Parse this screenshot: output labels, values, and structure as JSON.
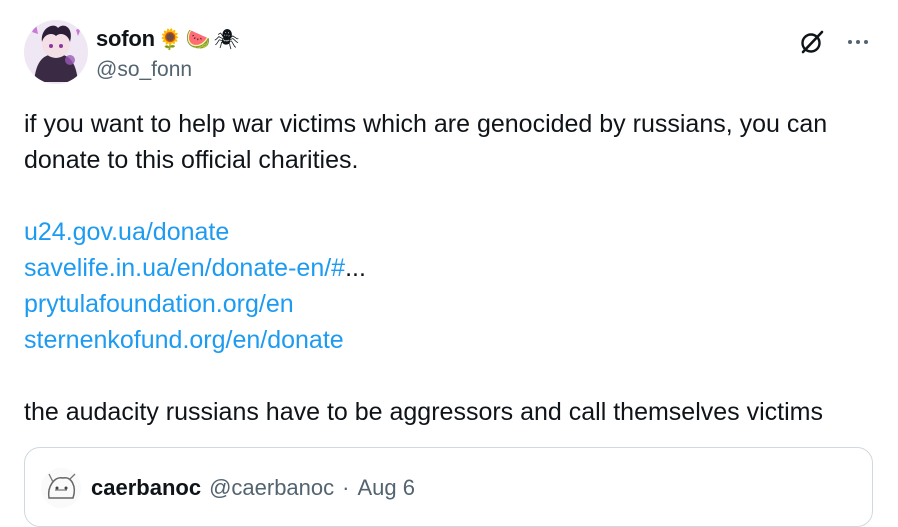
{
  "author": {
    "display_name": "sofon",
    "name_emojis": [
      "🌻",
      "🍉",
      "🕷"
    ],
    "handle": "@so_fonn"
  },
  "actions": {
    "grok_icon": "grok-icon",
    "more_icon": "more-horizontal-icon",
    "more_label": "···"
  },
  "tweet": {
    "paragraph1": "if you want to help war victims which are genocided by russians, you can donate to this official charities.",
    "links": [
      {
        "text": "u24.gov.ua/donate"
      },
      {
        "text": "savelife.in.ua/en/donate-en/#",
        "suffix": "..."
      },
      {
        "text": "prytulafoundation.org/en"
      },
      {
        "text": "sternenkofund.org/en/donate"
      }
    ],
    "paragraph2": "the audacity russians have to be aggressors and call themselves victims"
  },
  "quoted": {
    "display_name": "caerbanoc",
    "handle": "@caerbanoc",
    "separator": "·",
    "date": "Aug 6"
  },
  "colors": {
    "text": "#0f1419",
    "secondary": "#536471",
    "link": "#1d9bf0",
    "border": "#cfd9de"
  }
}
